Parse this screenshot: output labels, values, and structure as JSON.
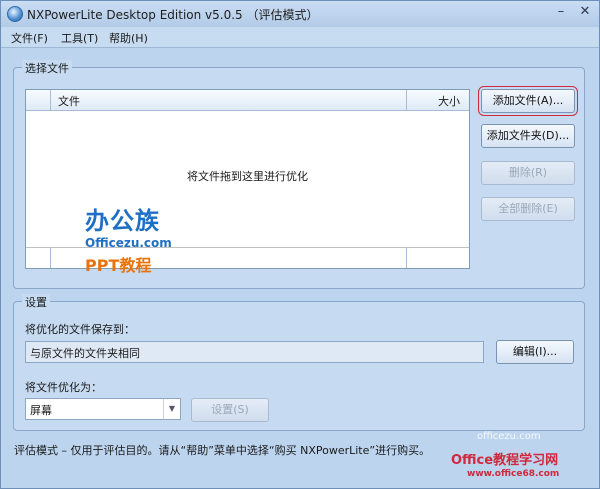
{
  "window": {
    "title": "NXPowerLite Desktop Edition v5.0.5 （评估模式）"
  },
  "window_buttons": {
    "minimize": "–",
    "close": "✕"
  },
  "menu": {
    "items": [
      "文件(F)",
      "工具(T)",
      "帮助(H)"
    ]
  },
  "select_files": {
    "group_title": "选择文件",
    "columns": [
      "文件",
      "大小"
    ],
    "empty_hint": "将文件拖到这里进行优化",
    "buttons": {
      "add_file": "添加文件(A)...",
      "add_folder": "添加文件夹(D)...",
      "delete": "删除(R)",
      "delete_all": "全部删除(E)"
    }
  },
  "settings": {
    "group_title": "设置",
    "save_label": "将优化的文件保存到：",
    "save_value": "与原文件的文件夹相同",
    "edit_button": "编辑(I)...",
    "optimize_label": "将文件优化为：",
    "optimize_value": "屏幕",
    "settings_button": "设置(S)"
  },
  "status": "评估模式 – 仅用于评估目的。请从“帮助”菜单中选择“购买 NXPowerLite”进行购买。",
  "watermarks": {
    "logo_main": "办公族",
    "logo_site": "Officezu.com",
    "logo_sub": "PPT教程",
    "corner_top": "officezu.com",
    "corner_title": "Office教程学习网",
    "corner_url": "www.office68.com"
  },
  "colors": {
    "accent_red": "#d0283c",
    "orange": "#e8730c",
    "blue": "#1f6fc4"
  }
}
